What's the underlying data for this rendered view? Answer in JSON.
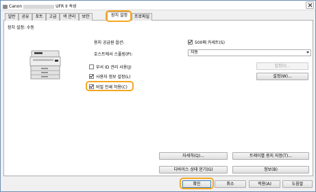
{
  "window": {
    "brand": "Canon",
    "model_suffix": "UFR II 속성"
  },
  "tabs": [
    {
      "label": "일반"
    },
    {
      "label": "공유"
    },
    {
      "label": "포트"
    },
    {
      "label": "고급"
    },
    {
      "label": "색 관리"
    },
    {
      "label": "보안"
    },
    {
      "label": "장치 설정"
    },
    {
      "label": "프로파일"
    }
  ],
  "active_tab": "장치 설정",
  "device_settings": {
    "section_title": "장치 설정: 수동",
    "paper_source_label": "용지 공급원 옵션:",
    "paper_source_option": {
      "label": "500매 카세트(S)",
      "checked": true
    },
    "spool_label": "호스트에서 스풀링(P):",
    "spool_value": "자동",
    "dept_id_mgmt": {
      "label": "부서 ID 관리 사용(J)",
      "checked": false
    },
    "dept_settings_button": "설정(I)...",
    "user_info_setting": {
      "label": "사용자 정보 설정(L)",
      "checked": true
    },
    "user_settings_button": "설정(W)...",
    "secure_print": {
      "label": "비밀 인쇄 허용(C)",
      "checked": true
    },
    "details_button": "자세히(Q)...",
    "tray_button": "트레이별 용지 지정(T)...",
    "device_status_button": "디바이스 상태 얻기(G)",
    "info_button": "정보(B)"
  },
  "footer": {
    "ok": "확인",
    "cancel": "취소",
    "apply": "적용(A)",
    "help": "도움말"
  },
  "colors": {
    "highlight": "#f5a623",
    "window_border": "#6b8fb5"
  }
}
